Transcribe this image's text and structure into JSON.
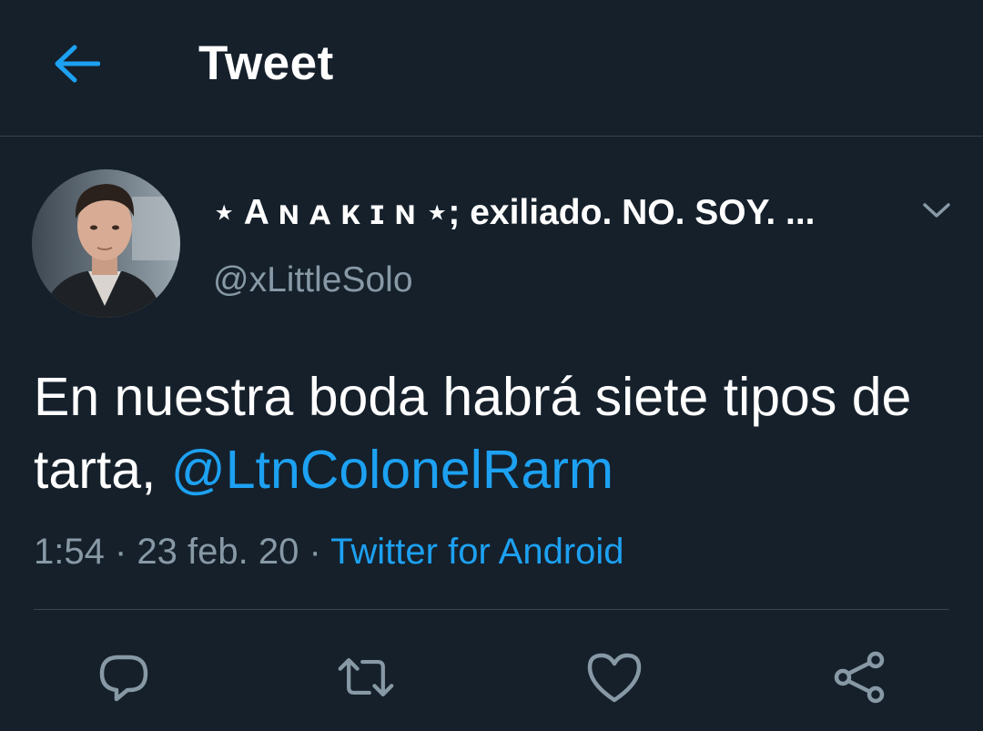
{
  "header": {
    "title": "Tweet",
    "back_icon": "arrow-left-icon"
  },
  "author": {
    "display_name": "⋆ A ɴ ᴀ ᴋ ɪ ɴ ⋆; exiliado. NO. SOY. ...",
    "handle": "@xLittleSolo"
  },
  "tweet": {
    "text_before": "En nuestra boda habrá siete tipos de tarta, ",
    "mention": "@LtnColonelRarm"
  },
  "meta": {
    "time": "1:54",
    "separator1": " · ",
    "date": "23 feb. 20",
    "separator2": " · ",
    "source": "Twitter for Android"
  },
  "actions": {
    "reply_icon": "reply-icon",
    "retweet_icon": "retweet-icon",
    "like_icon": "heart-icon",
    "share_icon": "share-icon"
  },
  "colors": {
    "background": "#15202b",
    "accent": "#1da1f2",
    "secondary_text": "#8899a6",
    "divider": "#38444d"
  }
}
